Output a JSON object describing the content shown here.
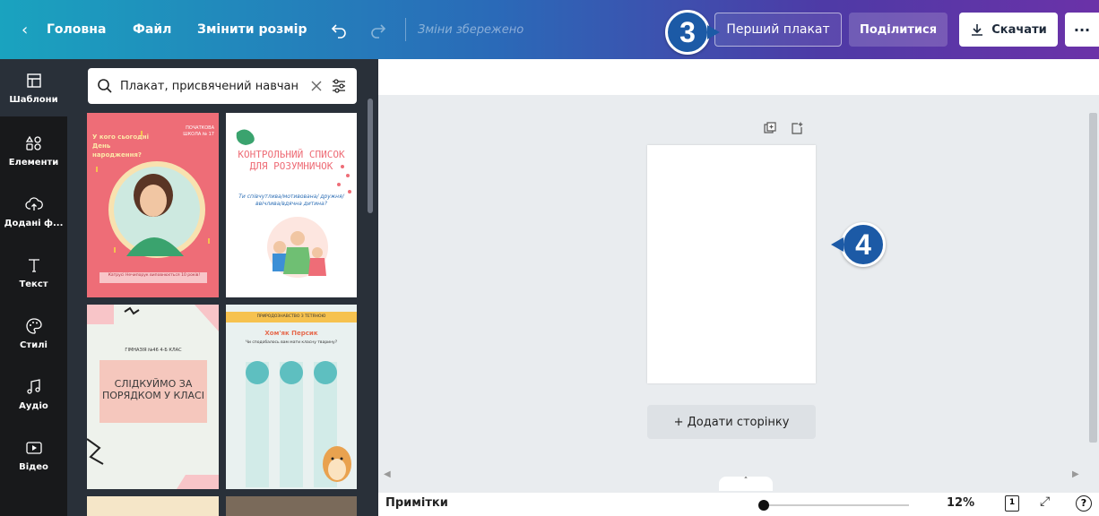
{
  "topbar": {
    "home_label": "Головна",
    "file_label": "Файл",
    "resize_label": "Змінити розмір",
    "saved_status": "Зміни збережено",
    "title_button": "Перший плакат",
    "share_label": "Поділитися",
    "download_label": "Скачати",
    "more_label": "···"
  },
  "callouts": {
    "first": "3",
    "second": "4"
  },
  "rail": {
    "items": [
      {
        "label": "Шаблони",
        "icon": "templates-icon"
      },
      {
        "label": "Елементи",
        "icon": "elements-icon"
      },
      {
        "label": "Додані ф...",
        "icon": "upload-icon"
      },
      {
        "label": "Текст",
        "icon": "text-icon"
      },
      {
        "label": "Стилі",
        "icon": "palette-icon"
      },
      {
        "label": "Аудіо",
        "icon": "audio-icon"
      },
      {
        "label": "Відео",
        "icon": "video-icon"
      }
    ]
  },
  "search": {
    "value": "Плакат, присвячений навчан"
  },
  "templates": {
    "t1": {
      "headline": "У кого сьогодні День народження?",
      "school": "ПОЧАТКОВА ШКОЛА № 17",
      "caption": "Катрусі Нечипорук виповнюється 10 років!"
    },
    "t2": {
      "title": "КОНТРОЛЬНИЙ СПИСОК ДЛЯ РОЗУМНИЧОК",
      "subtitle": "Ти співчутлива/мотивована/ дружня/ввічлива/вдячна дитина?"
    },
    "t3": {
      "school": "ГІМНАЗІЯ №46 4-Б КЛАС",
      "title": "СЛІДКУЙМО ЗА ПОРЯДКОМ У КЛАСІ"
    },
    "t4": {
      "banner": "ПРИРОДОЗНАВСТВО З ТЕТЯНОЮ",
      "title": "Хом'як Персик",
      "question": "Чи сподобалось вам мати класну тварину?"
    }
  },
  "canvas": {
    "add_page_label": "+ Додати сторінку"
  },
  "bottombar": {
    "notes_label": "Примітки",
    "zoom_percent": 12,
    "zoom_label": "12%",
    "page_count": "1",
    "help_label": "?"
  },
  "colors": {
    "rail": "#18191b",
    "panel": "#293039",
    "callout": "#1c5aa6",
    "canvas_bg": "#e9ecef"
  }
}
